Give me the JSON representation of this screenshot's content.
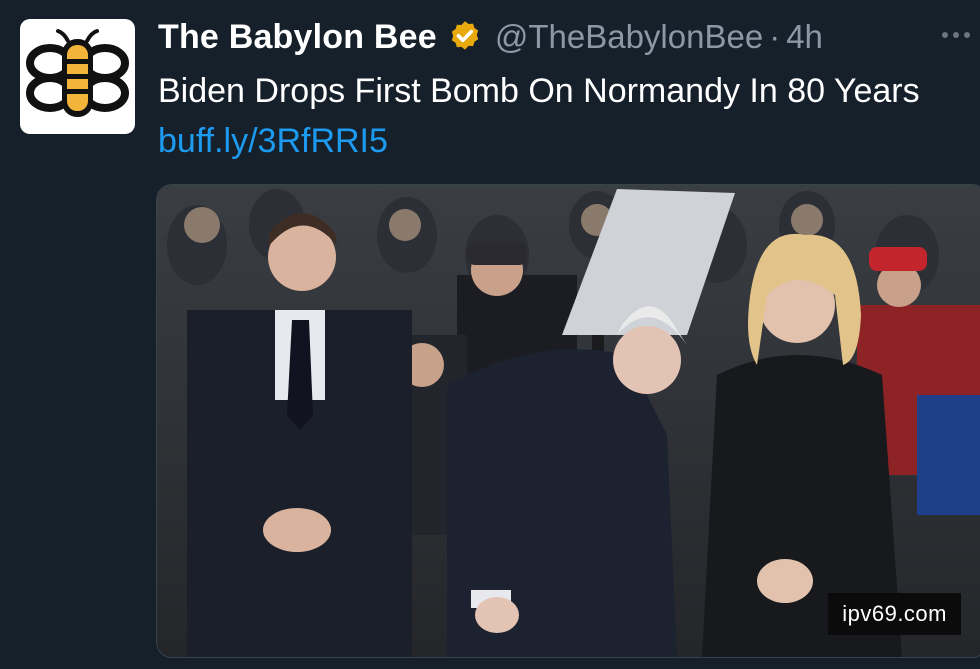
{
  "account": {
    "display_name": "The Babylon Bee",
    "handle": "@TheBabylonBee",
    "separator": "·",
    "time": "4h",
    "avatar_icon": "babylon-bee-logo",
    "verified_icon": "gold-verified-badge",
    "verified_color": "#f4b400"
  },
  "tweet": {
    "text": "Biden Drops First Bomb On Normandy In 80 Years",
    "link": "buff.ly/3RfRRI5"
  },
  "media": {
    "watermark": "ipv69.com"
  },
  "colors": {
    "background": "#15202b",
    "link": "#1d9bf0",
    "muted": "#8b98a5"
  }
}
